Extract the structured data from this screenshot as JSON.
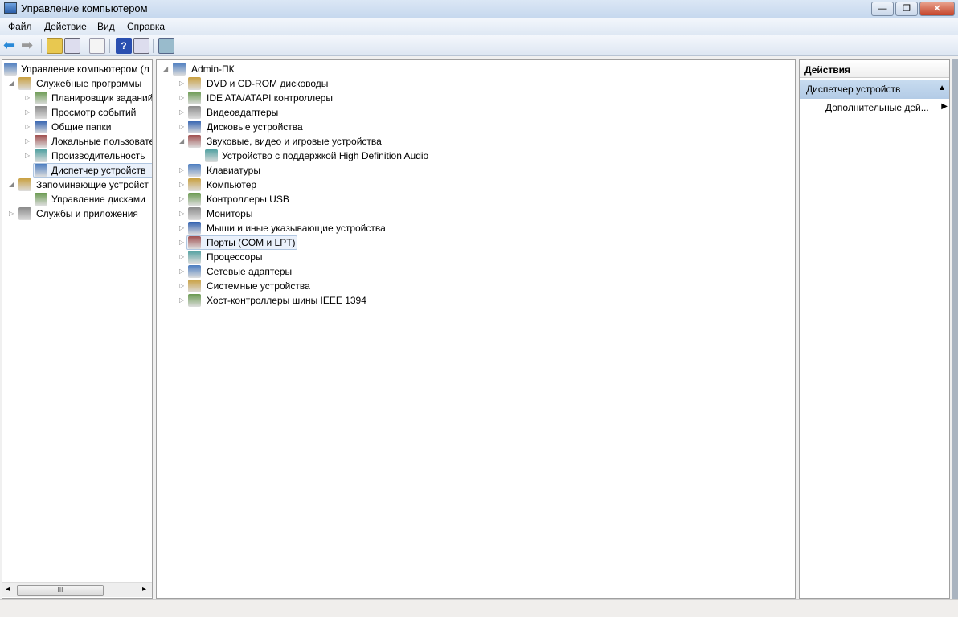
{
  "window": {
    "title": "Управление компьютером",
    "minimize": "—",
    "restore": "❐",
    "close": "✕"
  },
  "menu": [
    "Файл",
    "Действие",
    "Вид",
    "Справка"
  ],
  "toolbar": {
    "icons": [
      "back-icon",
      "forward-icon",
      "up-folder-icon",
      "show-tree-icon",
      "properties-icon",
      "help-icon",
      "show-actions-icon",
      "scan-hardware-icon"
    ]
  },
  "left_tree": [
    {
      "label": "Управление компьютером (л",
      "level": 0,
      "expander": ""
    },
    {
      "label": "Служебные программы",
      "level": 1,
      "expander": "◢"
    },
    {
      "label": "Планировщик заданий",
      "level": 2,
      "expander": "▷"
    },
    {
      "label": "Просмотр событий",
      "level": 2,
      "expander": "▷"
    },
    {
      "label": "Общие папки",
      "level": 2,
      "expander": "▷"
    },
    {
      "label": "Локальные пользовате",
      "level": 2,
      "expander": "▷"
    },
    {
      "label": "Производительность",
      "level": 2,
      "expander": "▷"
    },
    {
      "label": "Диспетчер устройств",
      "level": 2,
      "expander": "",
      "selected": true
    },
    {
      "label": "Запоминающие устройст",
      "level": 1,
      "expander": "◢"
    },
    {
      "label": "Управление дисками",
      "level": 2,
      "expander": ""
    },
    {
      "label": "Службы и приложения",
      "level": 1,
      "expander": "▷"
    }
  ],
  "device_tree": [
    {
      "label": "Admin-ПК",
      "level": 0,
      "expander": "◢"
    },
    {
      "label": "DVD и CD-ROM дисководы",
      "level": 1,
      "expander": "▷"
    },
    {
      "label": "IDE ATA/ATAPI контроллеры",
      "level": 1,
      "expander": "▷"
    },
    {
      "label": "Видеоадаптеры",
      "level": 1,
      "expander": "▷"
    },
    {
      "label": "Дисковые устройства",
      "level": 1,
      "expander": "▷"
    },
    {
      "label": "Звуковые, видео и игровые устройства",
      "level": 1,
      "expander": "◢"
    },
    {
      "label": "Устройство с поддержкой High Definition Audio",
      "level": 2,
      "expander": ""
    },
    {
      "label": "Клавиатуры",
      "level": 1,
      "expander": "▷"
    },
    {
      "label": "Компьютер",
      "level": 1,
      "expander": "▷"
    },
    {
      "label": "Контроллеры USB",
      "level": 1,
      "expander": "▷"
    },
    {
      "label": "Мониторы",
      "level": 1,
      "expander": "▷"
    },
    {
      "label": "Мыши и иные указывающие устройства",
      "level": 1,
      "expander": "▷"
    },
    {
      "label": "Порты (COM и LPT)",
      "level": 1,
      "expander": "▷",
      "selected": true
    },
    {
      "label": "Процессоры",
      "level": 1,
      "expander": "▷"
    },
    {
      "label": "Сетевые адаптеры",
      "level": 1,
      "expander": "▷"
    },
    {
      "label": "Системные устройства",
      "level": 1,
      "expander": "▷"
    },
    {
      "label": "Хост-контроллеры шины IEEE 1394",
      "level": 1,
      "expander": "▷"
    }
  ],
  "actions": {
    "header": "Действия",
    "section": "Диспетчер устройств",
    "section_arrow": "▲",
    "item": "Дополнительные дей...",
    "item_arrow": "▶"
  },
  "scrollbar": {
    "left": "◂",
    "right": "▸",
    "grip": "III"
  }
}
